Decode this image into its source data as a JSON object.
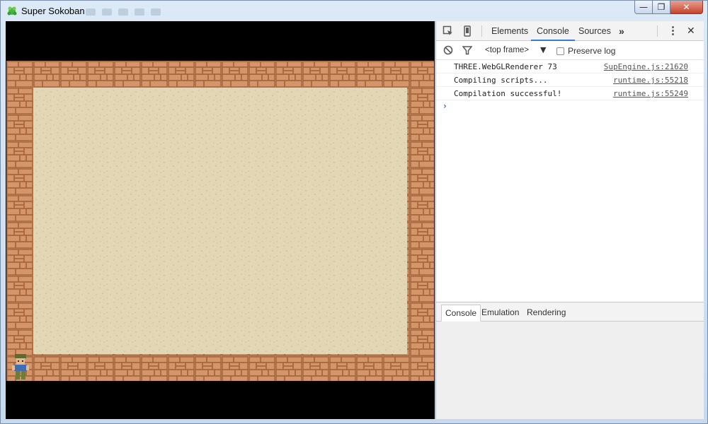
{
  "window": {
    "title": "Super Sokoban",
    "controls": {
      "minimize": "—",
      "maximize": "❐",
      "close": "✕"
    }
  },
  "game": {
    "colors": {
      "brick": "#d4956a",
      "mortar": "#a8693f",
      "sand": "#e3d6b5",
      "background": "#000000"
    },
    "player_icon": "player-sprite-icon"
  },
  "devtools": {
    "tabs": [
      "Elements",
      "Console",
      "Sources"
    ],
    "active_tab": "Console",
    "more_tabs_glyph": "»",
    "menu_glyph": "⋮",
    "close_glyph": "✕",
    "filter": {
      "frame_select": "<top frame>",
      "frame_arrow": "▼",
      "preserve_log_label": "Preserve log"
    },
    "console_messages": [
      {
        "text": "THREE.WebGLRenderer 73",
        "source": "SupEngine.js:21620"
      },
      {
        "text": "Compiling scripts...",
        "source": "runtime.js:55218"
      },
      {
        "text": "Compilation successful!",
        "source": "runtime.js:55249"
      }
    ],
    "prompt_glyph": "›",
    "drawer": {
      "tabs": [
        "Console",
        "Emulation",
        "Rendering"
      ],
      "active_tab": "Console"
    },
    "accent_color": "#3879d9"
  }
}
